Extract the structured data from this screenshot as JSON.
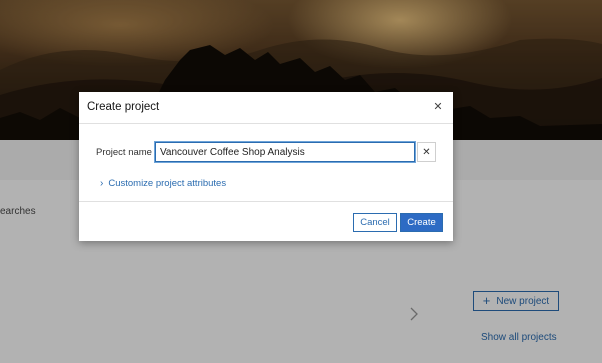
{
  "background": {
    "searches_text": "earches",
    "new_project_label": "New project",
    "new_project_icon": "plus-icon",
    "show_all_label": "Show all projects"
  },
  "dialog": {
    "title": "Create project",
    "close_icon": "close-icon",
    "project_name_label": "Project name",
    "project_name_value": "Vancouver Coffee Shop Analysis",
    "clear_icon": "clear-icon",
    "customize_label": "Customize project attributes",
    "cancel_label": "Cancel",
    "create_label": "Create"
  },
  "colors": {
    "accent": "#2d6bc4",
    "link": "#2b6cb0"
  }
}
